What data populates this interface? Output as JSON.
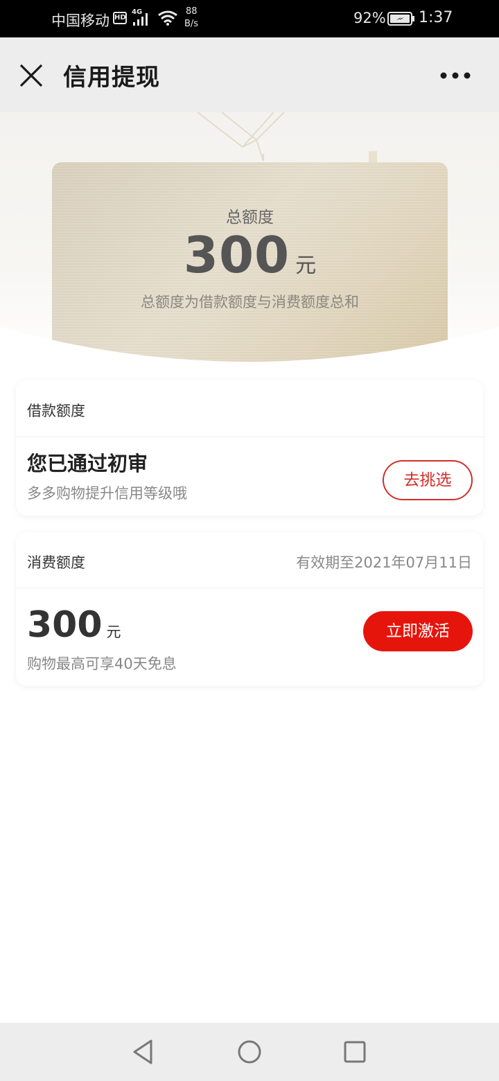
{
  "status_bar": {
    "carrier": "中国移动",
    "hd": "HD",
    "network": "4G",
    "speed_value": "88",
    "speed_unit": "B/s",
    "battery_percent": "92%",
    "time": "1:37"
  },
  "title_bar": {
    "title": "信用提现",
    "close_icon": "close-icon",
    "more_icon": "more-icon"
  },
  "total_card": {
    "label": "总额度",
    "amount": "300",
    "unit": "元",
    "note": "总额度为借款额度与消费额度总和"
  },
  "loan_quota": {
    "heading": "借款额度",
    "status_title": "您已通过初审",
    "status_subtitle": "多多购物提升信用等级哦",
    "button_label": "去挑选"
  },
  "spending_quota": {
    "heading": "消费额度",
    "validity": "有效期至2021年07月11日",
    "amount": "300",
    "unit": "元",
    "subtitle": "购物最高可享40天免息",
    "button_label": "立即激活"
  },
  "colors": {
    "accent_red": "#e5150c",
    "outline_red": "#d12f2a",
    "card_gold": "#e2d7c0"
  }
}
